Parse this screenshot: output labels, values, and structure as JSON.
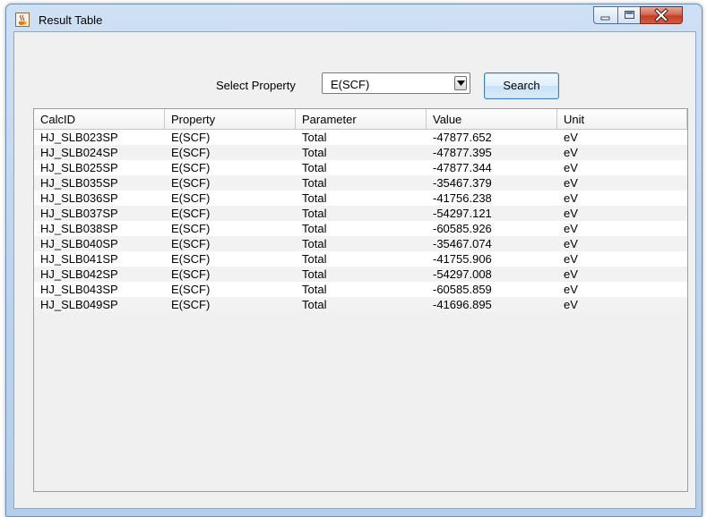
{
  "window": {
    "title": "Result Table"
  },
  "controls": {
    "select_label": "Select Property",
    "property_selected": "E(SCF)",
    "search_label": "Search"
  },
  "table": {
    "headers": [
      "CalcID",
      "Property",
      "Parameter",
      "Value",
      "Unit"
    ],
    "rows": [
      [
        "HJ_SLB023SP",
        "E(SCF)",
        "Total",
        "-47877.652",
        "eV"
      ],
      [
        "HJ_SLB024SP",
        "E(SCF)",
        "Total",
        "-47877.395",
        "eV"
      ],
      [
        "HJ_SLB025SP",
        "E(SCF)",
        "Total",
        "-47877.344",
        "eV"
      ],
      [
        "HJ_SLB035SP",
        "E(SCF)",
        "Total",
        "-35467.379",
        "eV"
      ],
      [
        "HJ_SLB036SP",
        "E(SCF)",
        "Total",
        "-41756.238",
        "eV"
      ],
      [
        "HJ_SLB037SP",
        "E(SCF)",
        "Total",
        "-54297.121",
        "eV"
      ],
      [
        "HJ_SLB038SP",
        "E(SCF)",
        "Total",
        "-60585.926",
        "eV"
      ],
      [
        "HJ_SLB040SP",
        "E(SCF)",
        "Total",
        "-35467.074",
        "eV"
      ],
      [
        "HJ_SLB041SP",
        "E(SCF)",
        "Total",
        "-41755.906",
        "eV"
      ],
      [
        "HJ_SLB042SP",
        "E(SCF)",
        "Total",
        "-54297.008",
        "eV"
      ],
      [
        "HJ_SLB043SP",
        "E(SCF)",
        "Total",
        "-60585.859",
        "eV"
      ],
      [
        "HJ_SLB049SP",
        "E(SCF)",
        "Total",
        "-41696.895",
        "eV"
      ]
    ]
  },
  "icons": {
    "app": "java-cup-icon",
    "minimize": "minimize-icon",
    "maximize": "maximize-icon",
    "close": "close-icon",
    "dropdown": "chevron-down-icon"
  },
  "colors": {
    "titlebar": "#bcd3ee",
    "close_button": "#c2402a",
    "search_button_border": "#3c7fb1",
    "row_alt": "#f2f2f2"
  }
}
